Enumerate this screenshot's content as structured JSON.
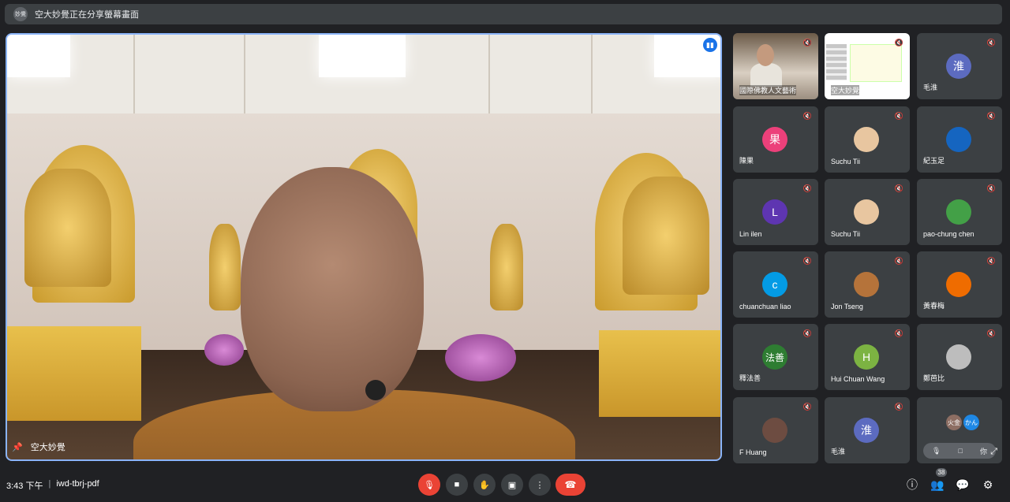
{
  "banner": {
    "avatar_text": "妙覺",
    "text": "空大妙覺正在分享螢幕畫面"
  },
  "main_video": {
    "name": "空大妙覺"
  },
  "tiles": [
    {
      "name": "國際佛教人文藝術",
      "type": "video"
    },
    {
      "name": "空大妙覺",
      "type": "screen"
    },
    {
      "name": "毛淮",
      "avatar": "淮",
      "color": "#5c6bc0"
    },
    {
      "name": "陳果",
      "avatar": "果",
      "color": "#ec407a"
    },
    {
      "name": "Suchu Tii",
      "avatar": "",
      "color": "#e8c6a0"
    },
    {
      "name": "紀玉足",
      "avatar": "",
      "color": "#1565c0"
    },
    {
      "name": "Lin ilen",
      "avatar": "L",
      "color": "#5e35b1"
    },
    {
      "name": "Suchu Tii",
      "avatar": "",
      "color": "#e8c6a0"
    },
    {
      "name": "pao-chung chen",
      "avatar": "",
      "color": "#43a047"
    },
    {
      "name": "chuanchuan liao",
      "avatar": "c",
      "color": "#039be5"
    },
    {
      "name": "Jon Tseng",
      "avatar": "",
      "color": "#b5733a"
    },
    {
      "name": "黃春梅",
      "avatar": "",
      "color": "#ef6c00"
    },
    {
      "name": "釋法善",
      "avatar": "法善",
      "color": "#2e7d32"
    },
    {
      "name": "Hui Chuan Wang",
      "avatar": "H",
      "color": "#7cb342"
    },
    {
      "name": "鄭芭比",
      "avatar": "",
      "color": "#bdbdbd"
    },
    {
      "name": "F Huang",
      "avatar": "",
      "color": "#6d4c41"
    },
    {
      "name": "毛淮",
      "avatar": "淮",
      "color": "#5c6bc0"
    },
    {
      "name": "",
      "type": "more",
      "avatars": [
        "火金",
        "かん"
      ],
      "you_label": "你"
    }
  ],
  "bottom": {
    "time": "3:43 下午",
    "separator": "|",
    "meeting_code": "iwd-tbrj-pdf",
    "participant_count": "38"
  }
}
